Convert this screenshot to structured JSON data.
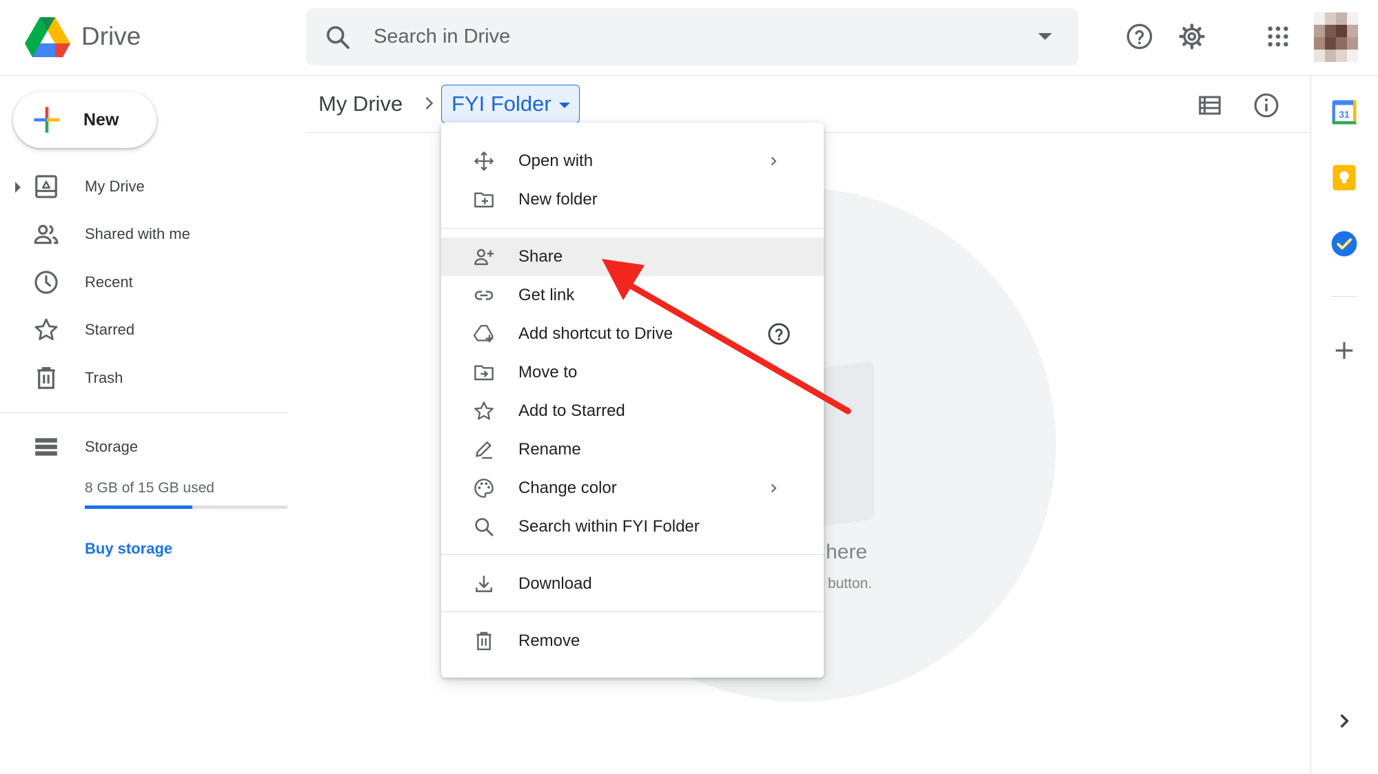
{
  "app": {
    "title": "Drive"
  },
  "search": {
    "placeholder": "Search in Drive"
  },
  "sidebar": {
    "new_label": "New",
    "items": [
      {
        "label": "My Drive"
      },
      {
        "label": "Shared with me"
      },
      {
        "label": "Recent"
      },
      {
        "label": "Starred"
      },
      {
        "label": "Trash"
      },
      {
        "label": "Storage"
      }
    ],
    "storage_text": "8 GB of 15 GB used",
    "storage_used_fraction": 0.53,
    "buy_storage": "Buy storage"
  },
  "breadcrumb": {
    "root": "My Drive",
    "current": "FYI Folder"
  },
  "empty_state": {
    "title_fragment": "here",
    "subtitle_fragment": "” button."
  },
  "context_menu": {
    "items": [
      {
        "label": "Open with"
      },
      {
        "label": "New folder"
      },
      {
        "label": "Share"
      },
      {
        "label": "Get link"
      },
      {
        "label": "Add shortcut to Drive"
      },
      {
        "label": "Move to"
      },
      {
        "label": "Add to Starred"
      },
      {
        "label": "Rename"
      },
      {
        "label": "Change color"
      },
      {
        "label": "Search within FYI Folder"
      },
      {
        "label": "Download"
      },
      {
        "label": "Remove"
      }
    ]
  },
  "rail": {
    "calendar_day": "31"
  },
  "colors": {
    "accent": "#1a73e8",
    "annotation_arrow": "#f2261c",
    "menu_hover": "#eeeeee"
  }
}
